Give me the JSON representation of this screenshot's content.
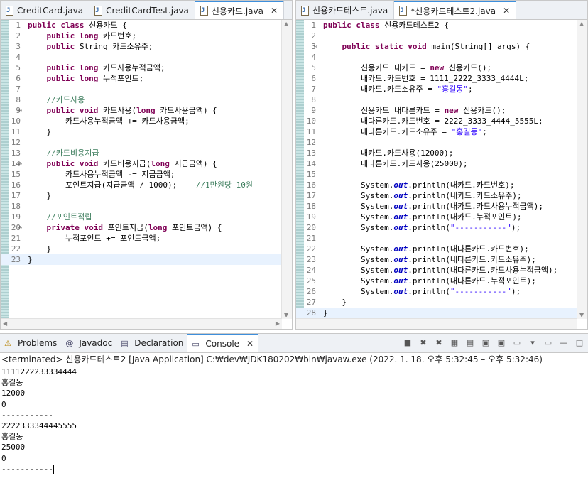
{
  "left_editor": {
    "tabs": [
      {
        "label": "CreditCard.java",
        "active": false
      },
      {
        "label": "CreditCardTest.java",
        "active": false
      },
      {
        "label": "신용카드.java",
        "active": true
      }
    ],
    "lines": [
      [
        [
          "kw",
          "public "
        ],
        [
          "kw",
          "class "
        ],
        [
          "",
          "신용카드 {"
        ]
      ],
      [
        [
          "",
          "    "
        ],
        [
          "kw",
          "public "
        ],
        [
          "kw",
          "long "
        ],
        [
          "",
          "카드번호;"
        ]
      ],
      [
        [
          "",
          "    "
        ],
        [
          "kw",
          "public "
        ],
        [
          "",
          "String 카드소유주;"
        ]
      ],
      [
        [
          "",
          ""
        ]
      ],
      [
        [
          "",
          "    "
        ],
        [
          "kw",
          "public "
        ],
        [
          "kw",
          "long "
        ],
        [
          "",
          "카드사용누적금액;"
        ]
      ],
      [
        [
          "",
          "    "
        ],
        [
          "kw",
          "public "
        ],
        [
          "kw",
          "long "
        ],
        [
          "",
          "누적포인트;"
        ]
      ],
      [
        [
          "",
          ""
        ]
      ],
      [
        [
          "",
          "    "
        ],
        [
          "cm",
          "//카드사용"
        ]
      ],
      [
        [
          "",
          "    "
        ],
        [
          "kw",
          "public "
        ],
        [
          "kw",
          "void "
        ],
        [
          "",
          "카드사용("
        ],
        [
          "kw",
          "long "
        ],
        [
          "",
          "카드사용금액) {"
        ]
      ],
      [
        [
          "",
          "        카드사용누적금액 += 카드사용금액;"
        ]
      ],
      [
        [
          "",
          "    }"
        ]
      ],
      [
        [
          "",
          ""
        ]
      ],
      [
        [
          "",
          "    "
        ],
        [
          "cm",
          "//카드비용지급"
        ]
      ],
      [
        [
          "",
          "    "
        ],
        [
          "kw",
          "public "
        ],
        [
          "kw",
          "void "
        ],
        [
          "",
          "카드비용지급("
        ],
        [
          "kw",
          "long "
        ],
        [
          "",
          "지급금액) {"
        ]
      ],
      [
        [
          "",
          "        카드사용누적금액 -= 지급금액;"
        ]
      ],
      [
        [
          "",
          "        포인트지급(지급금액 / 1000);    "
        ],
        [
          "cm",
          "//1만원당 10원"
        ]
      ],
      [
        [
          "",
          "    }"
        ]
      ],
      [
        [
          "",
          ""
        ]
      ],
      [
        [
          "",
          "    "
        ],
        [
          "cm",
          "//포인트적립"
        ]
      ],
      [
        [
          "",
          "    "
        ],
        [
          "kw",
          "private "
        ],
        [
          "kw",
          "void "
        ],
        [
          "",
          "포인트지급("
        ],
        [
          "kw",
          "long "
        ],
        [
          "",
          "포인트금액) {"
        ]
      ],
      [
        [
          "",
          "        누적포인트 += 포인트금액;"
        ]
      ],
      [
        [
          "",
          "    }"
        ]
      ],
      [
        [
          "",
          "}"
        ]
      ]
    ],
    "fold_lines": [
      9,
      14,
      20
    ],
    "current_line": 23
  },
  "right_editor": {
    "tabs": [
      {
        "label": "신용카드테스트.java",
        "active": false
      },
      {
        "label": "*신용카드테스트2.java",
        "active": true
      }
    ],
    "lines": [
      [
        [
          "kw",
          "public "
        ],
        [
          "kw",
          "class "
        ],
        [
          "",
          "신용카드테스트2 {"
        ]
      ],
      [
        [
          "",
          ""
        ]
      ],
      [
        [
          "",
          "    "
        ],
        [
          "kw",
          "public "
        ],
        [
          "kw",
          "static "
        ],
        [
          "kw",
          "void "
        ],
        [
          "",
          "main(String[] args) {"
        ]
      ],
      [
        [
          "",
          ""
        ]
      ],
      [
        [
          "",
          "        신용카드 내카드 = "
        ],
        [
          "kw",
          "new "
        ],
        [
          "",
          "신용카드();"
        ]
      ],
      [
        [
          "",
          "        내카드.카드번호 = 1111_2222_3333_4444L;"
        ]
      ],
      [
        [
          "",
          "        내카드.카드소유주 = "
        ],
        [
          "st",
          "\"홍길동\""
        ],
        [
          "",
          ";"
        ]
      ],
      [
        [
          "",
          ""
        ]
      ],
      [
        [
          "",
          "        신용카드 내다른카드 = "
        ],
        [
          "kw",
          "new "
        ],
        [
          "",
          "신용카드();"
        ]
      ],
      [
        [
          "",
          "        내다른카드.카드번호 = 2222_3333_4444_5555L;"
        ]
      ],
      [
        [
          "",
          "        내다른카드.카드소유주 = "
        ],
        [
          "st",
          "\"홍길동\""
        ],
        [
          "",
          ";"
        ]
      ],
      [
        [
          "",
          ""
        ]
      ],
      [
        [
          "",
          "        내카드.카드사용(12000);"
        ]
      ],
      [
        [
          "",
          "        내다른카드.카드사용(25000);"
        ]
      ],
      [
        [
          "",
          ""
        ]
      ],
      [
        [
          "",
          "        System."
        ],
        [
          "sf",
          "out"
        ],
        [
          "",
          ".println(내카드.카드번호);"
        ]
      ],
      [
        [
          "",
          "        System."
        ],
        [
          "sf",
          "out"
        ],
        [
          "",
          ".println(내카드.카드소유주);"
        ]
      ],
      [
        [
          "",
          "        System."
        ],
        [
          "sf",
          "out"
        ],
        [
          "",
          ".println(내카드.카드사용누적금액);"
        ]
      ],
      [
        [
          "",
          "        System."
        ],
        [
          "sf",
          "out"
        ],
        [
          "",
          ".println(내카드.누적포인트);"
        ]
      ],
      [
        [
          "",
          "        System."
        ],
        [
          "sf",
          "out"
        ],
        [
          "",
          ".println("
        ],
        [
          "st",
          "\"-----------\""
        ],
        [
          "",
          ");"
        ]
      ],
      [
        [
          "",
          ""
        ]
      ],
      [
        [
          "",
          "        System."
        ],
        [
          "sf",
          "out"
        ],
        [
          "",
          ".println(내다른카드.카드번호);"
        ]
      ],
      [
        [
          "",
          "        System."
        ],
        [
          "sf",
          "out"
        ],
        [
          "",
          ".println(내다른카드.카드소유주);"
        ]
      ],
      [
        [
          "",
          "        System."
        ],
        [
          "sf",
          "out"
        ],
        [
          "",
          ".println(내다른카드.카드사용누적금액);"
        ]
      ],
      [
        [
          "",
          "        System."
        ],
        [
          "sf",
          "out"
        ],
        [
          "",
          ".println(내다른카드.누적포인트);"
        ]
      ],
      [
        [
          "",
          "        System."
        ],
        [
          "sf",
          "out"
        ],
        [
          "",
          ".println("
        ],
        [
          "st",
          "\"-----------\""
        ],
        [
          "",
          ");"
        ]
      ],
      [
        [
          "",
          "    }"
        ]
      ],
      [
        [
          "",
          "}"
        ]
      ]
    ],
    "fold_lines": [
      3
    ],
    "current_line": 28
  },
  "console": {
    "tabs": [
      {
        "label": "Problems",
        "icon": "problems-icon",
        "active": false
      },
      {
        "label": "Javadoc",
        "icon": "at-icon",
        "active": false
      },
      {
        "label": "Declaration",
        "icon": "declaration-icon",
        "active": false
      },
      {
        "label": "Console",
        "icon": "console-icon",
        "active": true
      }
    ],
    "status": "<terminated> 신용카드테스트2 [Java Application] C:₩dev₩JDK180202₩bin₩javaw.exe  (2022. 1. 18. 오후 5:32:45 – 오후 5:32:46)",
    "output": [
      "1111222233334444",
      "홍길동",
      "12000",
      "0",
      "-----------",
      "2222333344445555",
      "홍길동",
      "25000",
      "0",
      "-----------"
    ],
    "toolbar_icons": [
      "stop-icon",
      "remove-launch-icon",
      "remove-all-icon",
      "scroll-lock-icon",
      "word-wrap-icon",
      "show-on-output-icon",
      "show-on-error-icon",
      "pin-console-icon",
      "display-console-icon",
      "open-console-icon",
      "minimize-icon",
      "maximize-icon"
    ]
  }
}
